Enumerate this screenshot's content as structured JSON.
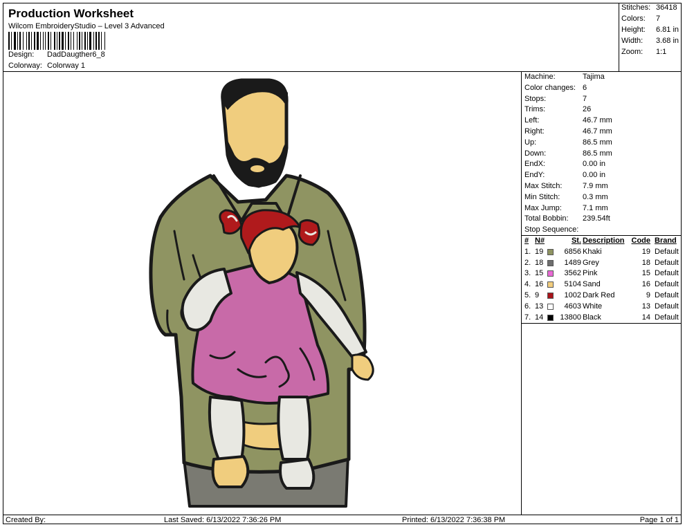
{
  "header": {
    "title": "Production Worksheet",
    "software": "Wilcom EmbroideryStudio – Level 3 Advanced",
    "design_label": "Design:",
    "design_value": "DadDaugther6_8",
    "colorway_label": "Colorway:",
    "colorway_value": "Colorway 1"
  },
  "summary": [
    {
      "label": "Stitches:",
      "value": "36418"
    },
    {
      "label": "Colors:",
      "value": "7"
    },
    {
      "label": "Height:",
      "value": "6.81 in"
    },
    {
      "label": "Width:",
      "value": "3.68 in"
    },
    {
      "label": "Zoom:",
      "value": "1:1"
    }
  ],
  "specs": [
    {
      "label": "Machine:",
      "value": "Tajima"
    },
    {
      "label": "Color changes:",
      "value": "6"
    },
    {
      "label": "Stops:",
      "value": "7"
    },
    {
      "label": "Trims:",
      "value": "26"
    },
    {
      "label": "Left:",
      "value": "46.7 mm"
    },
    {
      "label": "Right:",
      "value": "46.7 mm"
    },
    {
      "label": "Up:",
      "value": "86.5 mm"
    },
    {
      "label": "Down:",
      "value": "86.5 mm"
    },
    {
      "label": "EndX:",
      "value": "0.00 in"
    },
    {
      "label": "EndY:",
      "value": "0.00 in"
    },
    {
      "label": "Max Stitch:",
      "value": "7.9 mm"
    },
    {
      "label": "Min Stitch:",
      "value": "0.3 mm"
    },
    {
      "label": "Max Jump:",
      "value": "7.1 mm"
    },
    {
      "label": "Total Bobbin:",
      "value": "239.54ft"
    }
  ],
  "stop_sequence": {
    "title": "Stop Sequence:",
    "headers": {
      "num": "#",
      "n": "N#",
      "st": "St.",
      "desc": "Description",
      "code": "Code",
      "brand": "Brand"
    },
    "rows": [
      {
        "num": "1.",
        "n": "19",
        "color": "#8f9462",
        "st": "6856",
        "desc": "Khaki",
        "code": "19",
        "brand": "Default"
      },
      {
        "num": "2.",
        "n": "18",
        "color": "#6e6e6e",
        "st": "1489",
        "desc": "Grey",
        "code": "18",
        "brand": "Default"
      },
      {
        "num": "3.",
        "n": "15",
        "color": "#e86ad4",
        "st": "3562",
        "desc": "Pink",
        "code": "15",
        "brand": "Default"
      },
      {
        "num": "4.",
        "n": "16",
        "color": "#f2cd7e",
        "st": "5104",
        "desc": "Sand",
        "code": "16",
        "brand": "Default"
      },
      {
        "num": "5.",
        "n": "9",
        "color": "#a8141a",
        "st": "1002",
        "desc": "Dark Red",
        "code": "9",
        "brand": "Default"
      },
      {
        "num": "6.",
        "n": "13",
        "color": "#ffffff",
        "st": "4603",
        "desc": "White",
        "code": "13",
        "brand": "Default"
      },
      {
        "num": "7.",
        "n": "14",
        "color": "#000000",
        "st": "13800",
        "desc": "Black",
        "code": "14",
        "brand": "Default"
      }
    ]
  },
  "footer": {
    "created_by": "Created By:",
    "last_saved": "Last Saved: 6/13/2022 7:36:26 PM",
    "printed": "Printed: 6/13/2022 7:36:38 PM",
    "page": "Page 1 of 1"
  },
  "design_colors": {
    "khaki": "#8f9462",
    "grey": "#7a7a72",
    "pink": "#c86aa8",
    "sand": "#f0cd7e",
    "dark_red": "#b01a1c",
    "white": "#e8e8e2",
    "black": "#1a1a1a"
  }
}
